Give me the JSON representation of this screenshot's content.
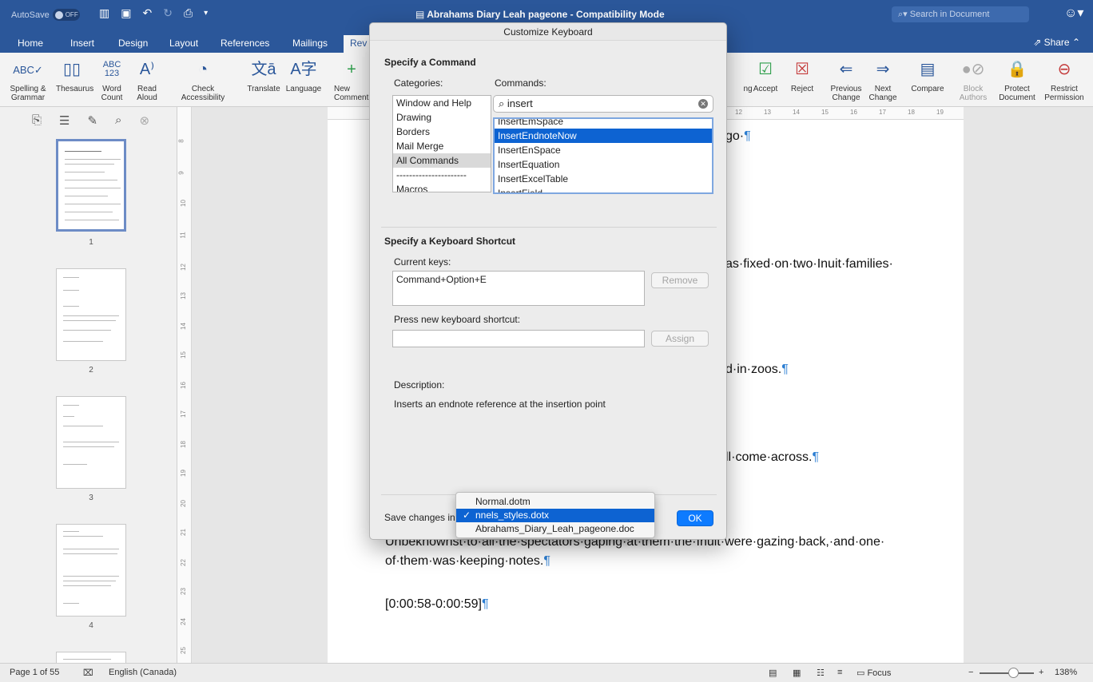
{
  "titlebar": {
    "autosave_label": "AutoSave",
    "autosave_state": "OFF",
    "document_title": "Abrahams Diary Leah pageone  -  Compatibility Mode",
    "search_placeholder": "Search in Document"
  },
  "tabs": [
    "Home",
    "Insert",
    "Design",
    "Layout",
    "References",
    "Mailings",
    "Rev"
  ],
  "share_label": "Share",
  "ribbon": {
    "spelling": "Spelling &\nGrammar",
    "thesaurus": "Thesaurus",
    "word_count": "Word\nCount",
    "read_aloud": "Read\nAloud",
    "check_accessibility": "Check\nAccessibility",
    "translate": "Translate",
    "language": "Language",
    "new_comment": "New\nComment",
    "accept": "Accept",
    "reject": "Reject",
    "previous_change": "Previous\nChange",
    "next_change": "Next\nChange",
    "compare": "Compare",
    "block_authors": "Block\nAuthors",
    "protect_document": "Protect\nDocument",
    "restrict_permission": "Restrict\nPermission"
  },
  "nav": {
    "pages": [
      "1",
      "2",
      "3",
      "4"
    ]
  },
  "vruler_numbers": [
    "8",
    "9",
    "10",
    "11",
    "12",
    "13",
    "14",
    "15",
    "16",
    "17",
    "18",
    "19",
    "20",
    "21",
    "22",
    "23",
    "24",
    "25"
  ],
  "hruler_numbers": [
    "12",
    "13",
    "14",
    "15",
    "16",
    "17",
    "18",
    "19"
  ],
  "document": {
    "frag1": "go·",
    "frag2": "as·fixed·on·two·Inuit·families·",
    "frag3": "d·in·zoos.",
    "frag4": "ll·come·across.",
    "line5": "Unbeknownst·to·all·the·spectators·gaping·at·them·the·Inuit·were·gazing·back,·and·one·",
    "line6": "of·them·was·keeping·notes.",
    "line7": "[0:00:58-0:00:59]",
    "pilcrow": "¶"
  },
  "dialog": {
    "title": "Customize Keyboard",
    "specify_command": "Specify a Command",
    "categories_label": "Categories:",
    "commands_label": "Commands:",
    "categories": [
      "Window and Help",
      "Drawing",
      "Borders",
      "Mail Merge",
      "All Commands",
      "----------------------",
      "Macros"
    ],
    "selected_category": "All Commands",
    "search_value": "insert",
    "commands": [
      "InsertEmSpace",
      "InsertEndnoteNow",
      "InsertEnSpace",
      "InsertEquation",
      "InsertExcelTable",
      "InsertField"
    ],
    "selected_command": "InsertEndnoteNow",
    "specify_shortcut": "Specify a Keyboard Shortcut",
    "current_keys_label": "Current keys:",
    "current_keys": [
      "Command+Option+E"
    ],
    "remove_label": "Remove",
    "press_new_label": "Press new keyboard shortcut:",
    "new_shortcut_value": "",
    "assign_label": "Assign",
    "description_label": "Description:",
    "description_text": "Inserts an endnote reference at the insertion point",
    "save_changes_label": "Save changes in",
    "ok_label": "OK"
  },
  "popup": {
    "options": [
      "Normal.dotm",
      "nnels_styles.dotx",
      "Abrahams_Diary_Leah_pageone.doc"
    ],
    "selected": "nnels_styles.dotx",
    "check": "✓"
  },
  "statusbar": {
    "page": "Page 1 of 55",
    "language": "English (Canada)",
    "focus": "Focus",
    "zoom": "138%"
  },
  "colors": {
    "title_blue": "#2b579a",
    "selection_blue": "#0d63d2",
    "ok_blue": "#0d7bff",
    "pilcrow_blue": "#2d7fd3"
  }
}
